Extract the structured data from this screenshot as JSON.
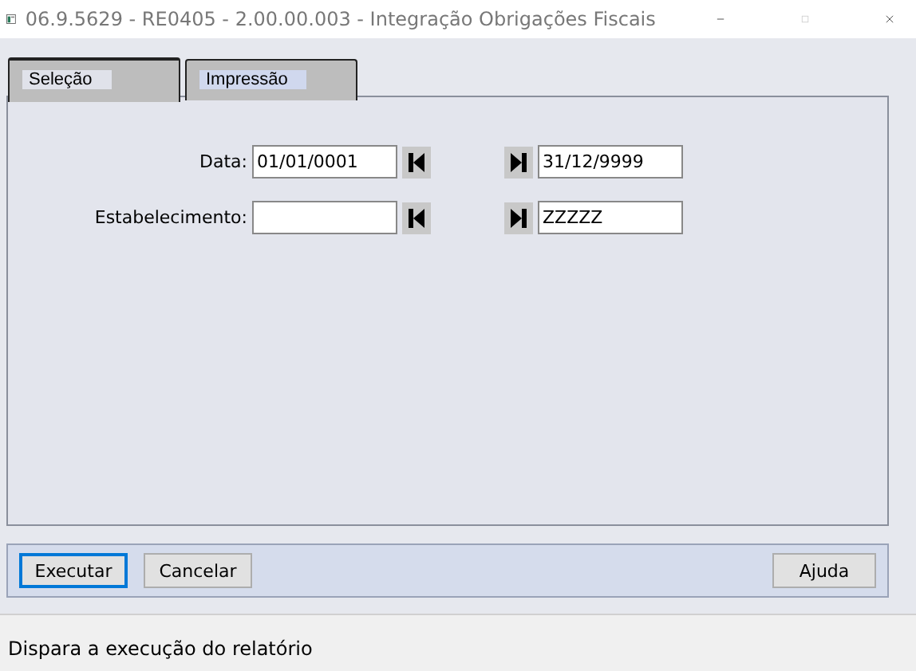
{
  "window": {
    "title": "06.9.5629 - RE0405 - 2.00.00.003 - Integração Obrigações Fiscais"
  },
  "tabs": [
    {
      "label": "Seleção",
      "selected": true
    },
    {
      "label": "Impressão",
      "selected": false
    }
  ],
  "fields": [
    {
      "label": "Data:",
      "from": "01/01/0001",
      "to": "31/12/9999"
    },
    {
      "label": "Estabelecimento:",
      "to": "ZZZZZ"
    }
  ],
  "buttons": [
    {
      "label": "Executar",
      "focused": true
    },
    {
      "label": "Cancelar",
      "focused": false
    }
  ],
  "help_button": "Ajuda",
  "status_bar": "Dispara a execução do relatório"
}
